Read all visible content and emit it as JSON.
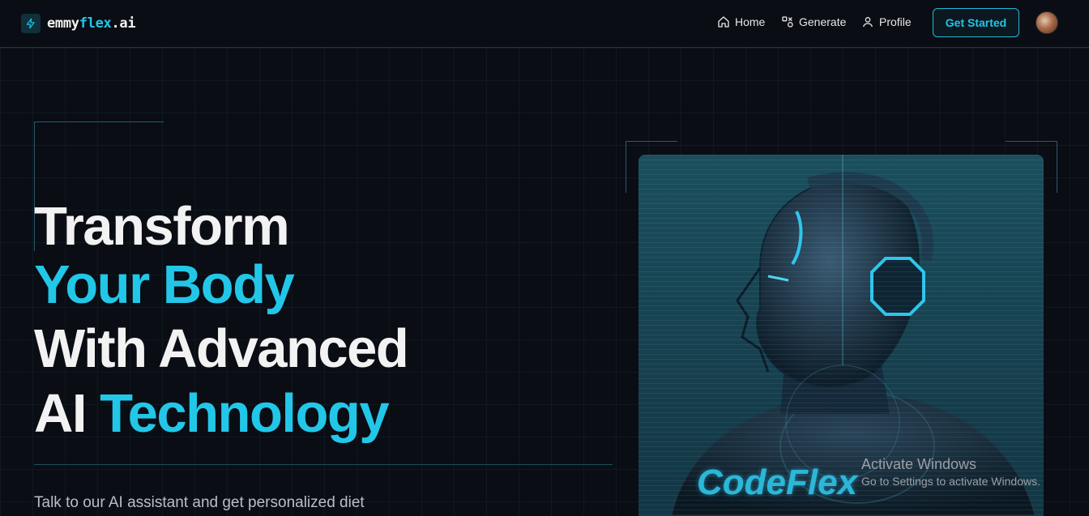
{
  "brand": {
    "part1": "emmy",
    "part2": "flex",
    "part3": ".ai",
    "accent": "#22c7e8"
  },
  "nav": {
    "links": [
      {
        "label": "Home",
        "icon": "home-icon"
      },
      {
        "label": "Generate",
        "icon": "generate-icon"
      },
      {
        "label": "Profile",
        "icon": "user-icon"
      }
    ],
    "cta": "Get Started"
  },
  "hero": {
    "line1": "Transform",
    "line2": "Your Body",
    "line3": "With Advanced",
    "line4_a": "AI ",
    "line4_b": "Technology",
    "subtext": "Talk to our AI assistant and get personalized diet"
  },
  "image": {
    "label": "CodeFlex"
  },
  "watermark": {
    "title": "Activate Windows",
    "subtitle": "Go to Settings to activate Windows."
  }
}
